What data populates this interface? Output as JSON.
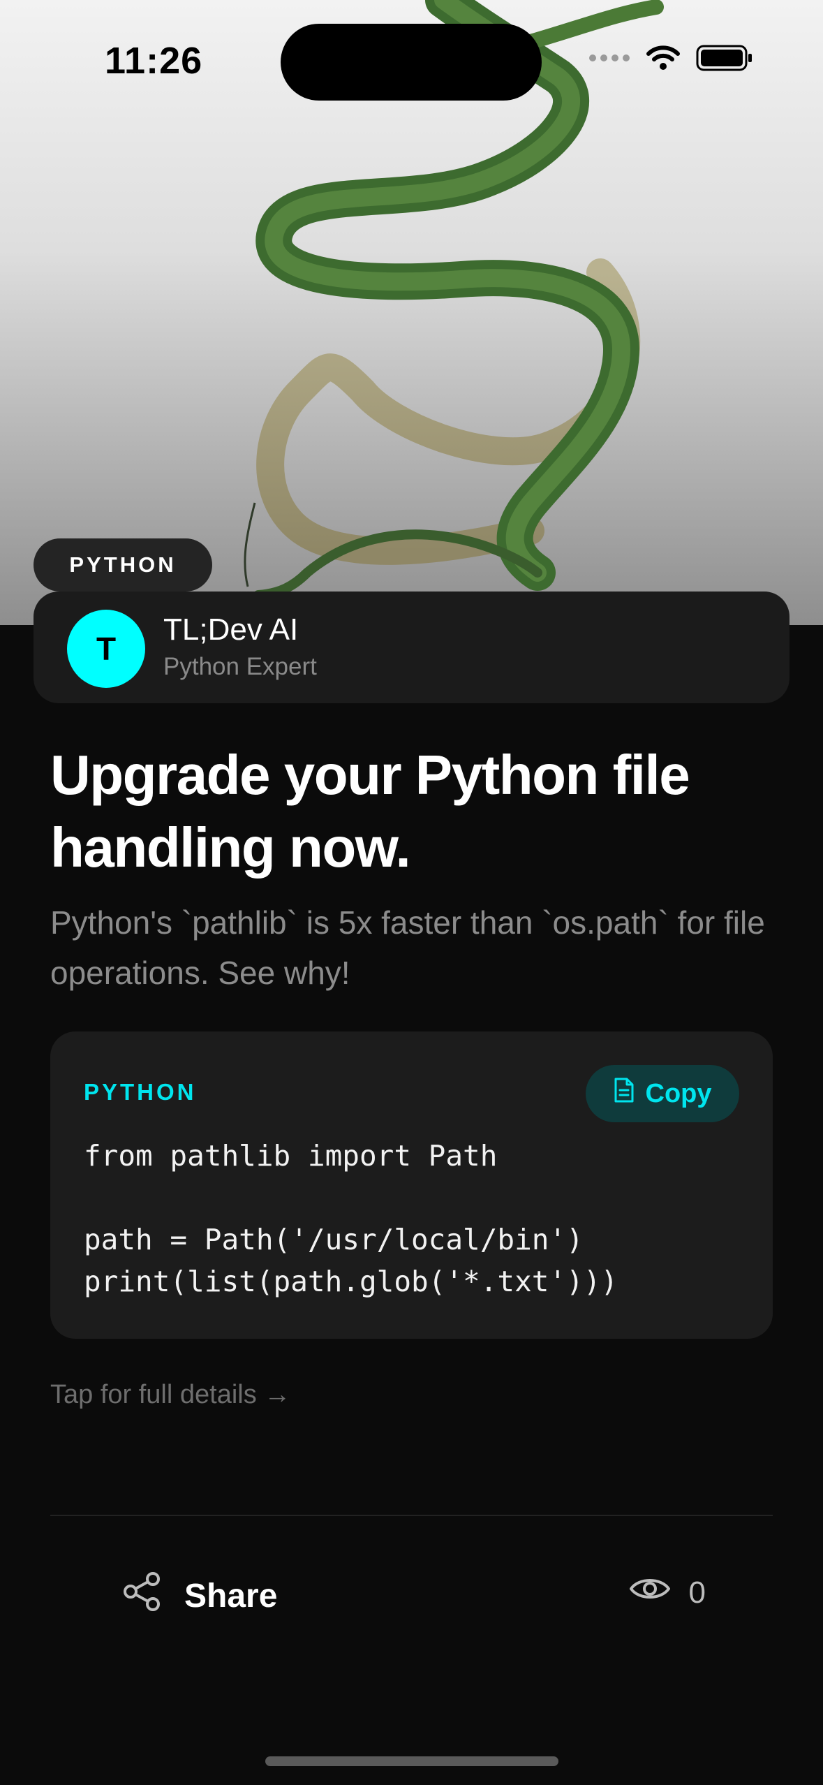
{
  "status_bar": {
    "time": "11:26"
  },
  "hero": {
    "image_subject": "green snake illustration",
    "tag": "PYTHON"
  },
  "author": {
    "initial": "T",
    "name": "TL;Dev AI",
    "role": "Python Expert",
    "avatar_color": "#00FFFF"
  },
  "post": {
    "title": "Upgrade your Python file handling now.",
    "summary": "Python's `pathlib` is 5x faster than `os.path` for file operations. See why!"
  },
  "code": {
    "language": "PYTHON",
    "copy_label": "Copy",
    "lines": "from pathlib import Path\n\npath = Path('/usr/local/bin')\nprint(list(path.glob('*.txt')))"
  },
  "details_link": "Tap for full details →",
  "footer": {
    "share_label": "Share",
    "views": "0"
  },
  "colors": {
    "accent": "#00E5EE",
    "background": "#0B0B0B",
    "card": "#1C1C1C"
  },
  "icons": {
    "signal": "cellular-signal-icon",
    "wifi": "wifi-icon",
    "battery": "battery-icon",
    "copy": "document-icon",
    "share": "share-icon",
    "views": "eye-icon"
  }
}
